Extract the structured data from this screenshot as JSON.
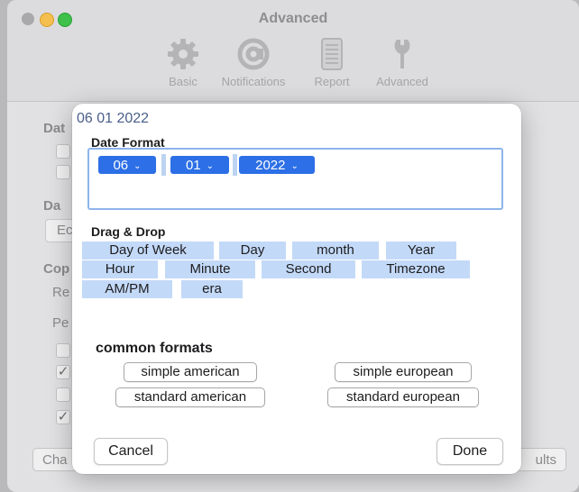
{
  "window": {
    "title": "Advanced",
    "toolbar": [
      {
        "label": "Basic",
        "icon": "gear-icon"
      },
      {
        "label": "Notifications",
        "icon": "at-sign-icon"
      },
      {
        "label": "Report",
        "icon": "document-icon"
      },
      {
        "label": "Advanced",
        "icon": "wrench-icon"
      }
    ],
    "background": {
      "section1": "Dat",
      "section2": "Da",
      "field2_text": "Ec",
      "section3": "Cop",
      "row_re": "Re",
      "row_pe": "Pe",
      "left_button": "Cha",
      "right_button": "ults"
    }
  },
  "sheet": {
    "preview": "06 01 2022",
    "date_format_label": "Date Format",
    "segments": [
      {
        "label": "06"
      },
      {
        "label": "01"
      },
      {
        "label": "2022"
      }
    ],
    "drag_drop_label": "Drag & Drop",
    "tokens": [
      "Day of Week",
      "Day",
      "month",
      "Year",
      "Hour",
      "Minute",
      "Second",
      "Timezone",
      "AM/PM",
      "era"
    ],
    "common_formats_label": "common formats",
    "formats": {
      "simple_american": "simple american",
      "simple_european": "simple european",
      "standard_american": "standard american",
      "standard_european": "standard european"
    },
    "cancel": "Cancel",
    "done": "Done"
  },
  "colors": {
    "accent": "#2c6fe6",
    "token_bg": "#c3d9f8",
    "preview_text": "#4a5f8a"
  }
}
